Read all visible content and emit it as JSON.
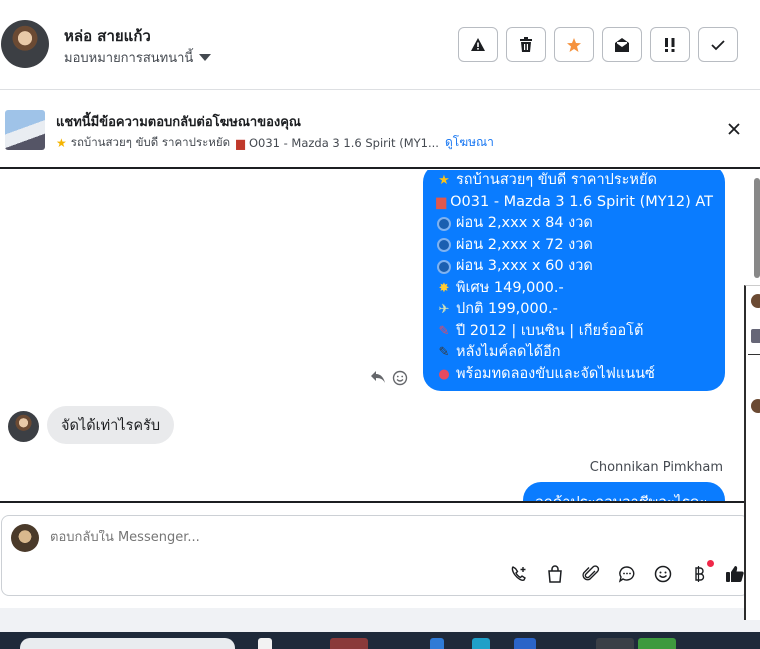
{
  "header": {
    "contact_name": "หล่อ สายแก้ว",
    "assign_label": "มอบหมายการสนทนานี้",
    "actions": [
      "report-icon",
      "trash-icon",
      "star-icon",
      "mark-unread-icon",
      "priority-icon",
      "done-check-icon"
    ],
    "star_color": "#f5923e"
  },
  "ad_banner": {
    "title": "แชทนี้มีข้อความตอบกลับต่อโฆษณาของคุณ",
    "sub_part1": "รถบ้านสวยๆ ขับดี ราคาประหยัด",
    "sub_part2": "O031 - Mazda 3 1.6 Spirit (MY1...",
    "link": "ดูโฆษณา"
  },
  "conversation": {
    "outgoing_lines": [
      {
        "icon": "star",
        "text": "รถบ้านสวยๆ ขับดี ราคาประหยัด"
      },
      {
        "icon": "car",
        "text": "O031 - Mazda 3 1.6 Spirit (MY12) AT"
      },
      {
        "icon": "circle",
        "text": "ผ่อน 2,xxx x 84 งวด"
      },
      {
        "icon": "circle",
        "text": "ผ่อน 2,xxx x 72 งวด"
      },
      {
        "icon": "circle",
        "text": "ผ่อน 3,xxx x 60 งวด"
      },
      {
        "icon": "boom",
        "text": "พิเศษ 149,000.-"
      },
      {
        "icon": "money",
        "text": "ปกติ 199,000.-"
      },
      {
        "icon": "pin",
        "text": "ปี 2012 | เบนซิน | เกียร์ออโต้"
      },
      {
        "icon": "mic",
        "text": "หลังไมค์ลดได้อีก"
      },
      {
        "icon": "pushpin",
        "text": "พร้อมทดลองขับและจัดไฟแนนซ์"
      }
    ],
    "incoming_message": "จัดได้เท่าไรครับ",
    "sender_name": "Chonnikan Pimkham",
    "partial_message": "ลูกค้าประกอบอาชีพอะไรคะ",
    "accent_color": "#0a7cff"
  },
  "composer": {
    "placeholder": "ตอบกลับใน Messenger...",
    "tools": [
      "call-add-icon",
      "shopping-bag-icon",
      "attach-icon",
      "saved-reply-icon",
      "emoji-icon",
      "baht-payment-icon",
      "like-icon"
    ]
  }
}
